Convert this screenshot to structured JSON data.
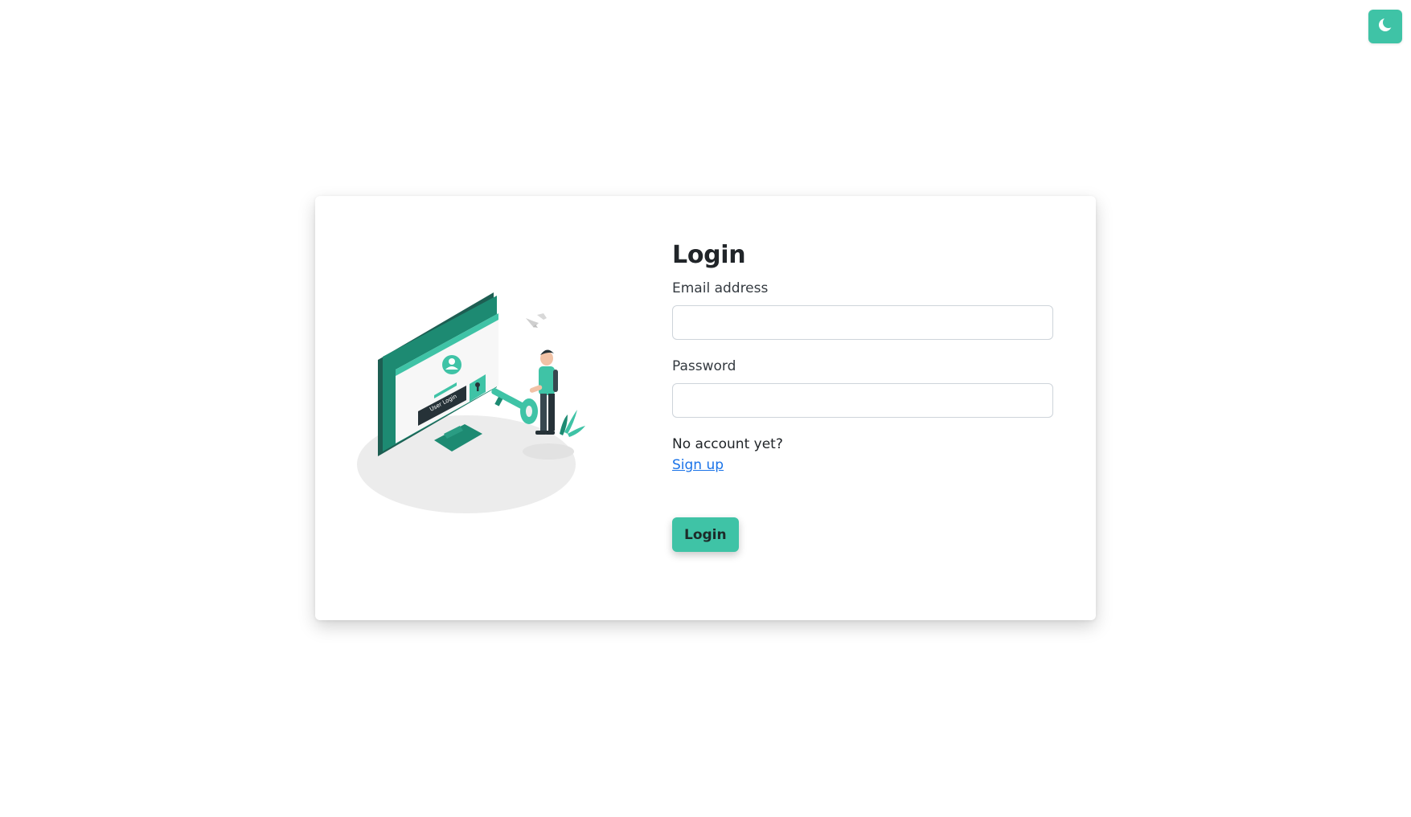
{
  "colors": {
    "accent": "#3fc3a6",
    "accent_dark": "#1d8a72",
    "link": "#1a73e8"
  },
  "theme_toggle": {
    "icon": "moon-icon"
  },
  "illustration": {
    "monitor_text": "User Login"
  },
  "login_form": {
    "title": "Login",
    "email_label": "Email address",
    "email_value": "",
    "password_label": "Password",
    "password_value": "",
    "no_account_text": "No account yet?",
    "signup_link": "Sign up",
    "submit_label": "Login"
  }
}
